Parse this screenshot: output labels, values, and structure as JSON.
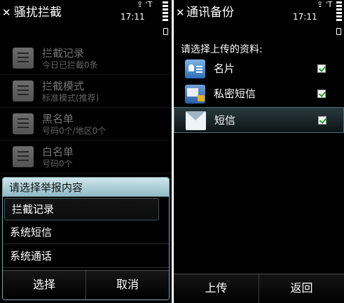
{
  "left": {
    "title": "骚扰拦截",
    "status_icons": "⇪ ˈT",
    "time": "17:11",
    "items": [
      {
        "title": "拦截记录",
        "subtitle": "今日已拦截0条",
        "icon": "list-icon"
      },
      {
        "title": "拦截模式",
        "subtitle": "标准模式(推荐)",
        "icon": "mode-icon"
      },
      {
        "title": "黑名单",
        "subtitle": "号码0个/地区0个",
        "icon": "blacklist-icon"
      },
      {
        "title": "白名单",
        "subtitle": "号码0个",
        "icon": "whitelist-icon"
      }
    ],
    "popup": {
      "title": "请选择举报内容",
      "options": [
        "拦截记录",
        "系统短信",
        "系统通话"
      ],
      "selected_index": 0,
      "select_label": "选择",
      "cancel_label": "取消"
    }
  },
  "right": {
    "title": "通讯备份",
    "status_icons": "⇪ ˈT",
    "time": "17:11",
    "prompt": "请选择上传的资料:",
    "options": [
      {
        "label": "名片",
        "icon": "contact-card-icon",
        "checked": true
      },
      {
        "label": "私密短信",
        "icon": "private-message-icon",
        "checked": true
      },
      {
        "label": "短信",
        "icon": "envelope-icon",
        "checked": true
      }
    ],
    "selected_index": 2,
    "upload_label": "上传",
    "back_label": "返回"
  },
  "colors": {
    "popup_title_bg": "#a9cdd6",
    "selection_border": "#4d6d76",
    "check_green": "#2c9a2c"
  }
}
